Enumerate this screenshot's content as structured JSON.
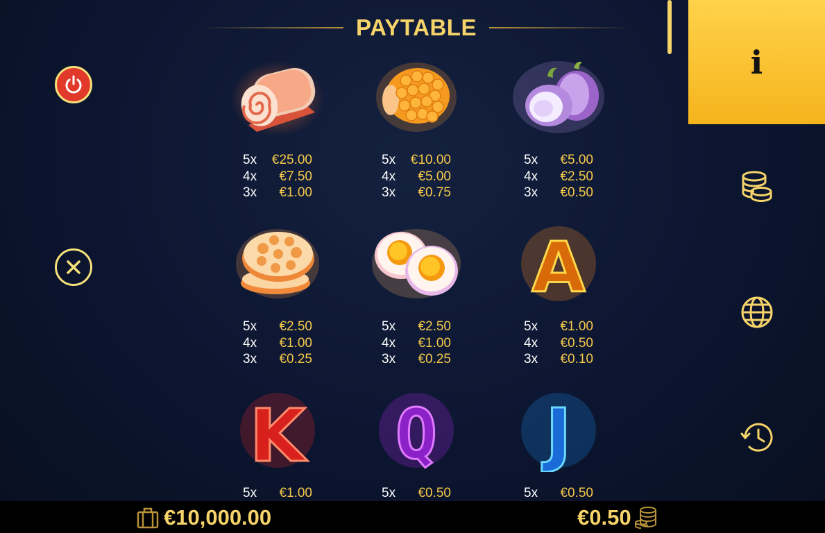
{
  "header": {
    "title": "PAYTABLE"
  },
  "left_controls": {
    "power_icon": "power-icon",
    "close_icon": "close-icon"
  },
  "side_menu": {
    "items": [
      {
        "icon": "info-icon",
        "glyph": "i",
        "active": true
      },
      {
        "icon": "coins-icon",
        "active": false
      },
      {
        "icon": "globe-icon",
        "active": false
      },
      {
        "icon": "history-icon",
        "active": false
      }
    ]
  },
  "paytable": {
    "symbols": [
      {
        "icon": "meat-roll-icon",
        "pays": [
          {
            "mult": "5x",
            "amt": "€25.00"
          },
          {
            "mult": "4x",
            "amt": "€7.50"
          },
          {
            "mult": "3x",
            "amt": "€1.00"
          }
        ]
      },
      {
        "icon": "corn-icon",
        "pays": [
          {
            "mult": "5x",
            "amt": "€10.00"
          },
          {
            "mult": "4x",
            "amt": "€5.00"
          },
          {
            "mult": "3x",
            "amt": "€0.75"
          }
        ]
      },
      {
        "icon": "onion-icon",
        "pays": [
          {
            "mult": "5x",
            "amt": "€5.00"
          },
          {
            "mult": "4x",
            "amt": "€2.50"
          },
          {
            "mult": "3x",
            "amt": "€0.50"
          }
        ]
      },
      {
        "icon": "lotus-root-icon",
        "pays": [
          {
            "mult": "5x",
            "amt": "€2.50"
          },
          {
            "mult": "4x",
            "amt": "€1.00"
          },
          {
            "mult": "3x",
            "amt": "€0.25"
          }
        ]
      },
      {
        "icon": "egg-icon",
        "pays": [
          {
            "mult": "5x",
            "amt": "€2.50"
          },
          {
            "mult": "4x",
            "amt": "€1.00"
          },
          {
            "mult": "3x",
            "amt": "€0.25"
          }
        ]
      },
      {
        "icon": "letter-a-icon",
        "letter": "A",
        "pays": [
          {
            "mult": "5x",
            "amt": "€1.00"
          },
          {
            "mult": "4x",
            "amt": "€0.50"
          },
          {
            "mult": "3x",
            "amt": "€0.10"
          }
        ]
      },
      {
        "icon": "letter-k-icon",
        "letter": "K",
        "pays": [
          {
            "mult": "5x",
            "amt": "€1.00"
          }
        ]
      },
      {
        "icon": "letter-q-icon",
        "letter": "Q",
        "pays": [
          {
            "mult": "5x",
            "amt": "€0.50"
          }
        ]
      },
      {
        "icon": "letter-j-icon",
        "letter": "J",
        "pays": [
          {
            "mult": "5x",
            "amt": "€0.50"
          }
        ]
      }
    ]
  },
  "footer": {
    "balance": "€10,000.00",
    "bet": "€0.50"
  },
  "colors": {
    "accent": "#f6d46a",
    "active_tab": "#ffc62e",
    "amount": "#f6c94a",
    "power": "#e23a2a"
  }
}
